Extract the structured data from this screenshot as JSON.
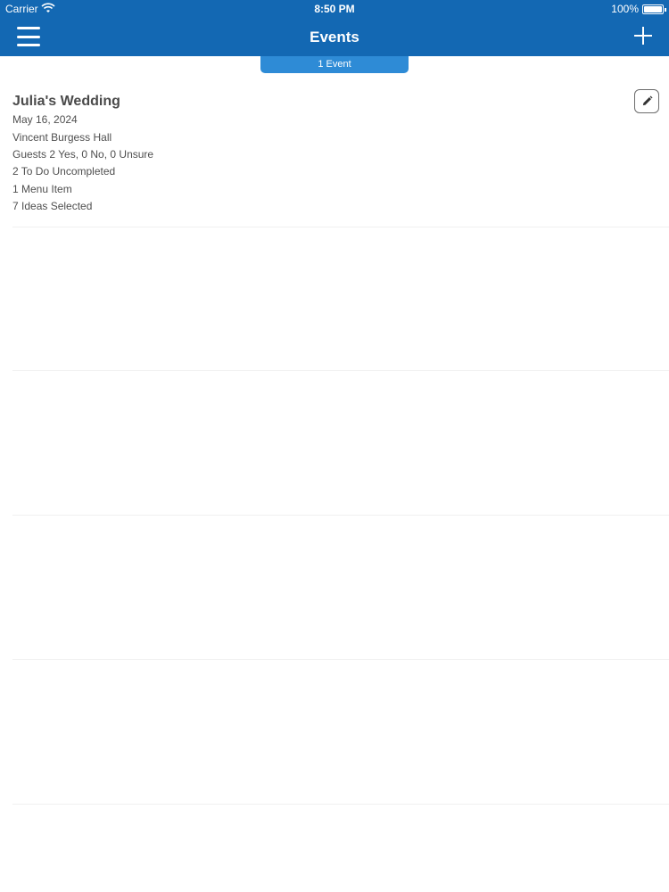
{
  "status_bar": {
    "carrier": "Carrier",
    "time": "8:50 PM",
    "battery": "100%"
  },
  "nav": {
    "title": "Events",
    "menu_icon": "hamburger-icon",
    "add_icon": "plus-icon"
  },
  "event_count": "1 Event",
  "events": [
    {
      "title": "Julia's Wedding",
      "date": "May 16, 2024",
      "venue": "Vincent Burgess Hall",
      "guests": "Guests 2 Yes, 0 No, 0 Unsure",
      "todos": "2 To Do Uncompleted",
      "menu": "1 Menu Item",
      "ideas": "7 Ideas Selected",
      "edit_icon": "pencil-icon"
    }
  ],
  "colors": {
    "accent": "#1368b3",
    "pill": "#2e8bd6",
    "text": "#4a4a4a"
  }
}
